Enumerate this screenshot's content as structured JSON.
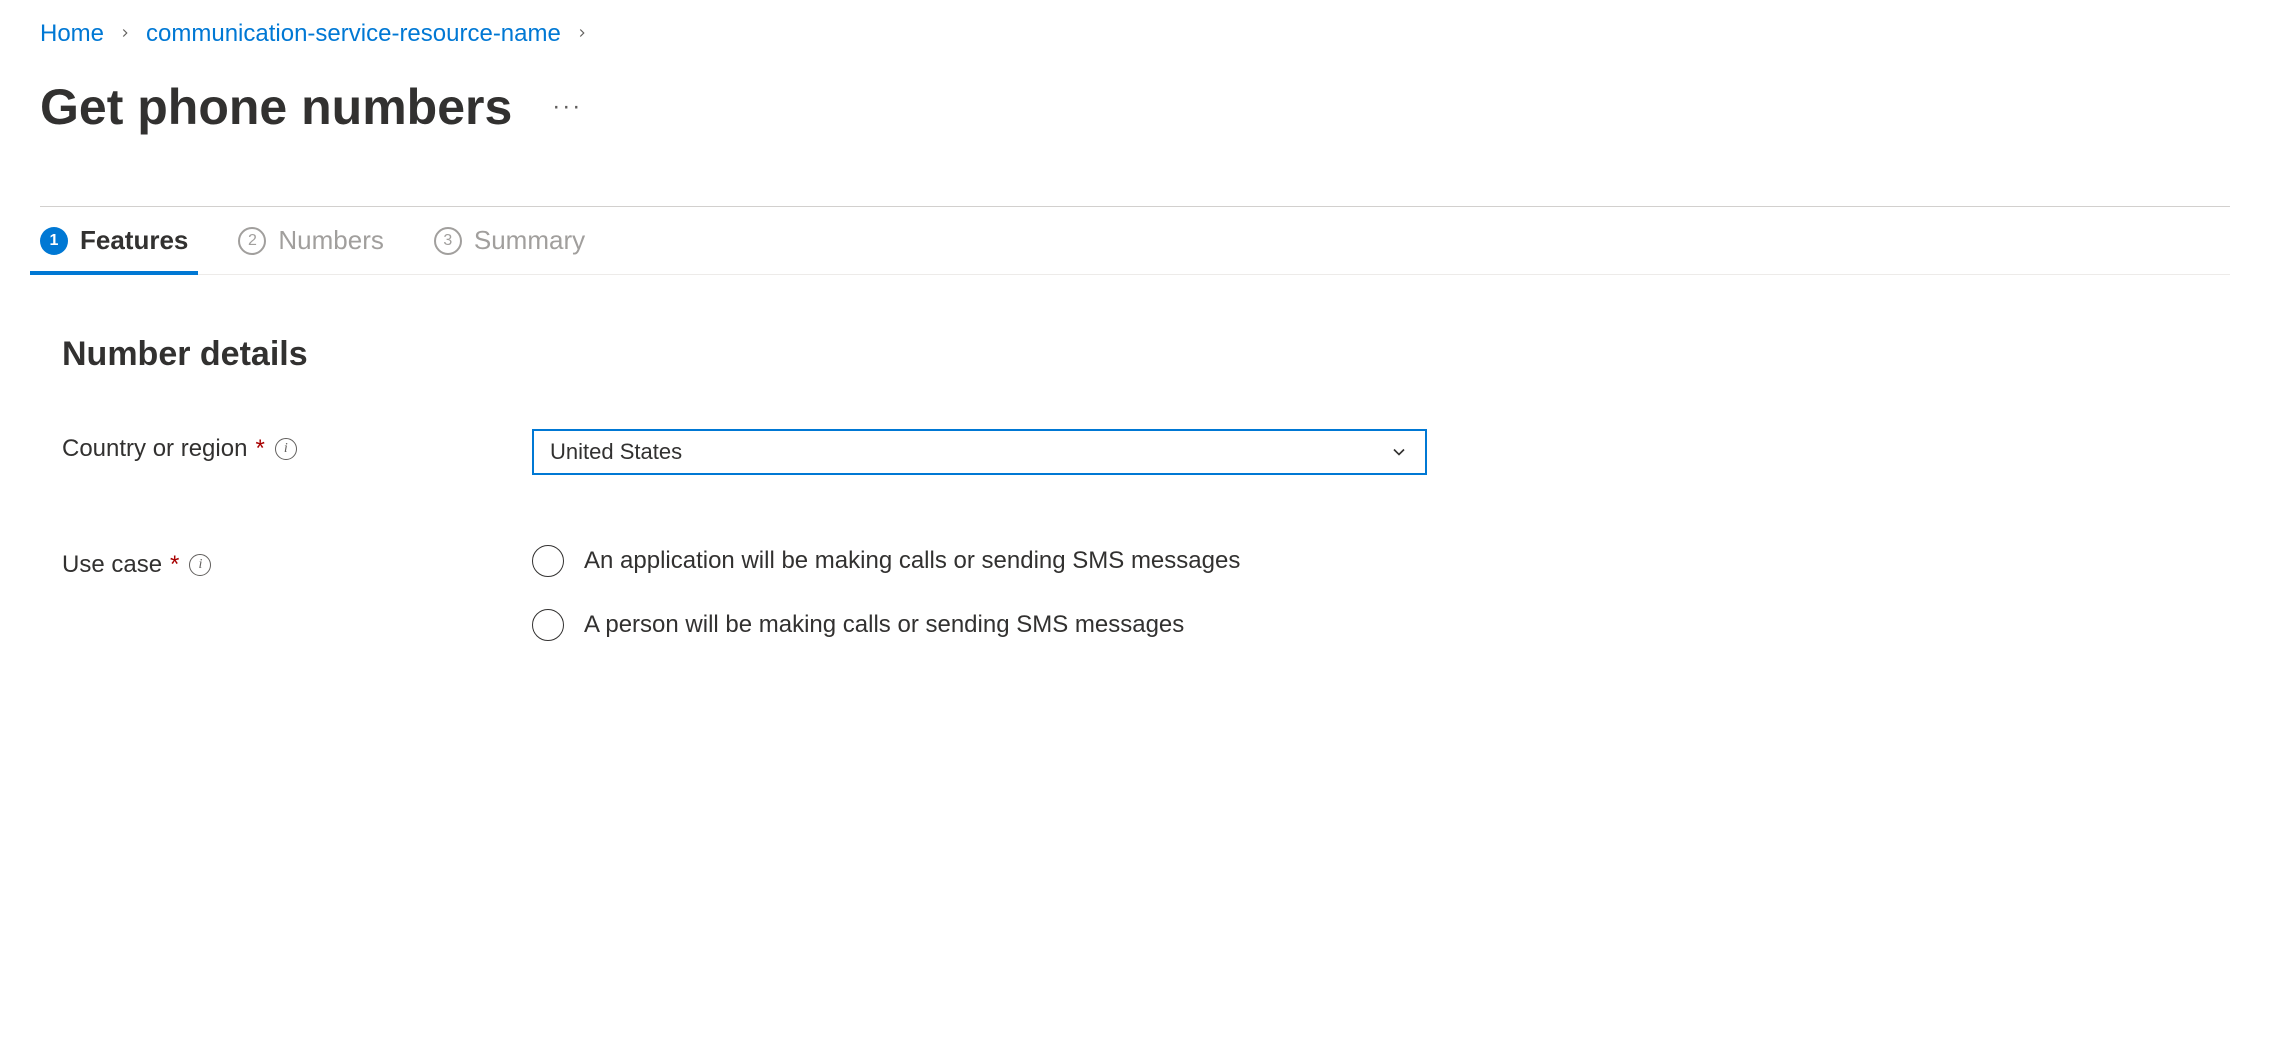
{
  "breadcrumb": {
    "items": [
      {
        "label": "Home"
      },
      {
        "label": "communication-service-resource-name"
      }
    ]
  },
  "page": {
    "title": "Get phone numbers"
  },
  "tabs": [
    {
      "num": "1",
      "label": "Features",
      "active": true
    },
    {
      "num": "2",
      "label": "Numbers",
      "active": false
    },
    {
      "num": "3",
      "label": "Summary",
      "active": false
    }
  ],
  "section": {
    "heading": "Number details"
  },
  "form": {
    "country": {
      "label": "Country or region",
      "value": "United States"
    },
    "usecase": {
      "label": "Use case",
      "options": [
        "An application will be making calls or sending SMS messages",
        "A person will be making calls or sending SMS messages"
      ]
    }
  }
}
